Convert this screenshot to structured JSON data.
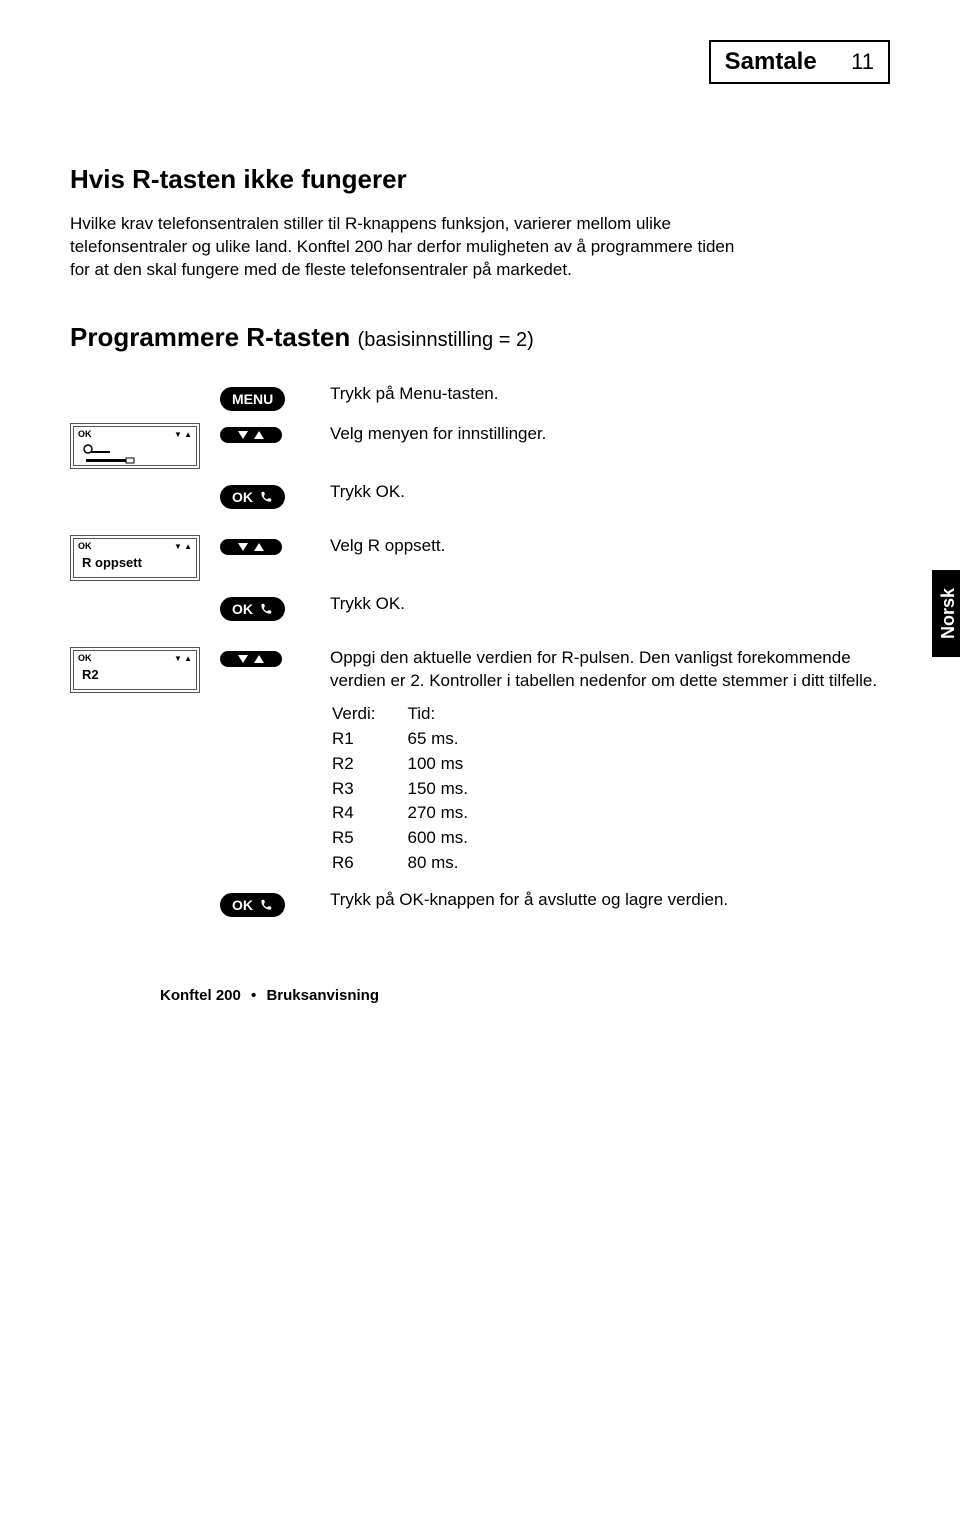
{
  "header": {
    "title": "Samtale",
    "page": "11"
  },
  "side_tab": "Norsk",
  "section1": {
    "heading": "Hvis R-tasten ikke fungerer",
    "intro": "Hvilke krav telefonsentralen stiller til R-knappens funksjon, varierer mellom ulike telefonsentraler og ulike land. Konftel 200 har derfor muligheten av å programmere tiden for at den skal fungere med de fleste telefonsentraler på markedet."
  },
  "section2": {
    "heading": "Programmere R-tasten",
    "basis": "(basisinnstilling = 2)"
  },
  "buttons": {
    "menu": "MENU",
    "ok": "OK"
  },
  "lcd": {
    "ok": "OK",
    "r_oppsett": "R oppsett",
    "r2": "R2"
  },
  "steps": {
    "s1": "Trykk på Menu-tasten.",
    "s2": "Velg menyen for innstillinger.",
    "s3": "Trykk OK.",
    "s4": "Velg R oppsett.",
    "s5": "Trykk OK.",
    "s6": "Oppgi den aktuelle verdien for R-pulsen. Den vanligst forekommende verdien er 2. Kontroller i tabellen nedenfor om dette stemmer i ditt tilfelle.",
    "s7": "Trykk på OK-knappen for å avslutte og lagre verdien."
  },
  "table": {
    "h1": "Verdi:",
    "h2": "Tid:",
    "rows": [
      {
        "v": "R1",
        "t": "65 ms."
      },
      {
        "v": "R2",
        "t": "100 ms"
      },
      {
        "v": "R3",
        "t": "150 ms."
      },
      {
        "v": "R4",
        "t": "270 ms."
      },
      {
        "v": "R5",
        "t": "600 ms."
      },
      {
        "v": "R6",
        "t": "80 ms."
      }
    ]
  },
  "footer": {
    "product": "Konftel 200",
    "doc": "Bruksanvisning"
  }
}
